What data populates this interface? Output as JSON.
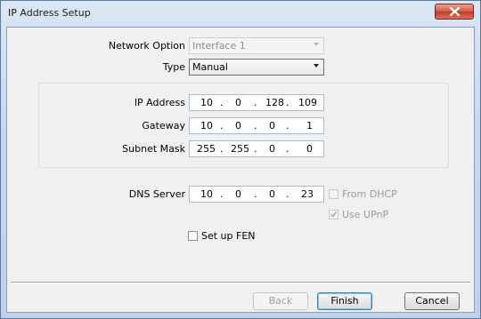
{
  "window": {
    "title": "IP Address Setup"
  },
  "network_option": {
    "label": "Network Option",
    "value": "Interface 1",
    "enabled": false
  },
  "type": {
    "label": "Type",
    "value": "Manual"
  },
  "ip_address": {
    "label": "IP Address",
    "octets": [
      "10",
      "0",
      "128",
      "109"
    ]
  },
  "gateway": {
    "label": "Gateway",
    "octets": [
      "10",
      "0",
      "0",
      "1"
    ]
  },
  "subnet_mask": {
    "label": "Subnet Mask",
    "octets": [
      "255",
      "255",
      "0",
      "0"
    ]
  },
  "dns_server": {
    "label": "DNS Server",
    "octets": [
      "10",
      "0",
      "0",
      "23"
    ]
  },
  "from_dhcp": {
    "label": "From DHCP",
    "checked": false,
    "enabled": false
  },
  "use_upnp": {
    "label": "Use UPnP",
    "checked": true,
    "enabled": false
  },
  "setup_fen": {
    "label": "Set up FEN",
    "checked": false
  },
  "buttons": {
    "back": "Back",
    "finish": "Finish",
    "cancel": "Cancel"
  },
  "ip_separator": "."
}
